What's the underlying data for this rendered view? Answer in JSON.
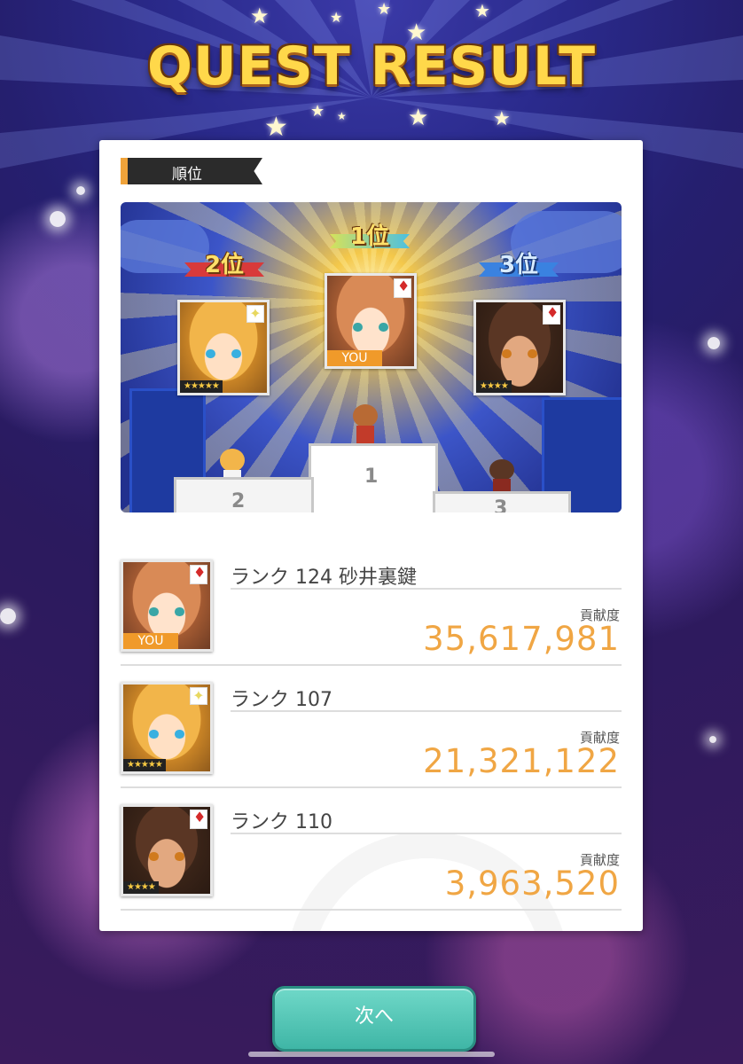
{
  "header": {
    "title": "QUEST RESULT"
  },
  "section": {
    "label": "順位"
  },
  "podium": {
    "ribbons": [
      {
        "place": "2位"
      },
      {
        "place": "1位"
      },
      {
        "place": "3位"
      }
    ],
    "cards": [
      {
        "stars": "★★★★★"
      },
      {
        "you_tag": "YOU"
      },
      {
        "stars": "★★★★"
      }
    ],
    "steps": {
      "first": "1",
      "second": "2",
      "third": "3"
    }
  },
  "results": [
    {
      "rank": "ランク 124 砂井裏鍵",
      "contribution_label": "貢献度",
      "score": "35,617,981",
      "you_tag": "YOU"
    },
    {
      "rank": "ランク 107",
      "contribution_label": "貢献度",
      "score": "21,321,122",
      "stars": "★★★★★"
    },
    {
      "rank": "ランク 110",
      "contribution_label": "貢献度",
      "score": "3,963,520",
      "stars": "★★★★"
    }
  ],
  "footer": {
    "next_button": "次へ"
  },
  "colors": {
    "accent_orange": "#f0a644",
    "button_teal": "#4fc4b4",
    "title_gold": "#ffd84a"
  },
  "icons": [
    "diamond-suit-icon",
    "sparkle-icon",
    "rarity-star-icon"
  ]
}
